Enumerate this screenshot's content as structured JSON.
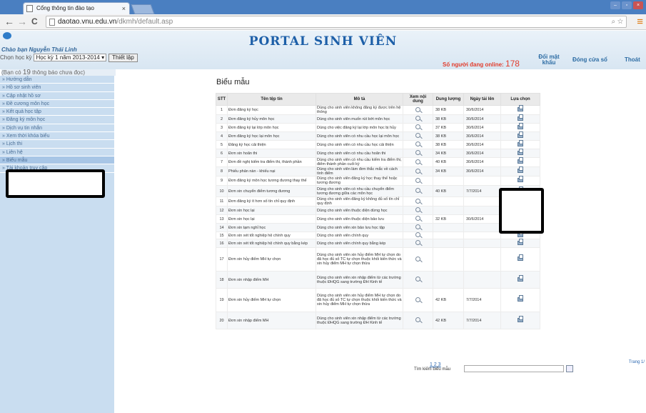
{
  "browser": {
    "tab_title": "Cổng thông tin đào tạo",
    "tab_close": "×",
    "url_host": "daotao.vnu.edu.vn",
    "url_path": "/dkmh/default.asp",
    "back": "←",
    "forward": "→",
    "reload": "C"
  },
  "header": {
    "portal_title": "PORTAL SINH VIÊN",
    "greeting": "Chào bạn Nguyễn Thái Linh",
    "semester_label": "Chọn học kỳ",
    "semester_value": "Học kỳ 1 năm 2013-2014",
    "setup_button": "Thiết lập",
    "online_label": "Số người đang online:",
    "online_count": "178",
    "change_password": "Đổi mật khẩu",
    "close_window": "Đóng cửa sổ",
    "logout": "Thoát"
  },
  "notice": {
    "prefix": "(Bạn có",
    "count": "19",
    "suffix": "thông báo chưa đọc)"
  },
  "sidebar": {
    "items": [
      {
        "label": "» Hướng dẫn"
      },
      {
        "label": "» Hồ sơ sinh viên"
      },
      {
        "label": "» Cập nhật hồ sơ"
      },
      {
        "label": "» Đề cương môn học"
      },
      {
        "label": "» Kết quả học tập"
      },
      {
        "label": "» Đăng ký môn học"
      },
      {
        "label": "» Dịch vụ tin nhắn"
      },
      {
        "label": "» Xem thời khóa biểu"
      },
      {
        "label": "» Lịch thi"
      },
      {
        "label": "» Liên hệ"
      },
      {
        "label": "» Biểu mẫu"
      },
      {
        "label": "» Tài khoản truy cập"
      }
    ]
  },
  "main": {
    "title": "Biểu mẫu",
    "columns": [
      "STT",
      "Tên tệp tin",
      "Mô tả",
      "Xem nội dung",
      "Dung lượng",
      "Ngày tải lên",
      "Lựa chọn"
    ],
    "rows": [
      {
        "stt": "1",
        "name": "Đơn đăng ký học",
        "desc": "Dùng cho sinh viên không đăng ký được trên hệ thống",
        "size": "38 KB",
        "date": "30/6/2014"
      },
      {
        "stt": "2",
        "name": "Đơn đăng ký hủy môn học",
        "desc": "Dùng cho sinh viên muốn rút bớt môn học",
        "size": "38 KB",
        "date": "30/6/2014"
      },
      {
        "stt": "3",
        "name": "Đơn đăng ký lại lớp môn học",
        "desc": "Dùng cho việc đăng ký lại lớp môn học bị hủy",
        "size": "37 KB",
        "date": "30/6/2014"
      },
      {
        "stt": "4",
        "name": "Đơn đăng ký học lại môn học",
        "desc": "Dùng cho sinh viên có nhu cầu học lại môn học",
        "size": "38 KB",
        "date": "30/6/2014"
      },
      {
        "stt": "5",
        "name": "Đăng ký học cải thiện",
        "desc": "Dùng cho sinh viên có nhu cầu học cải thiện",
        "size": "38 KB",
        "date": "30/6/2014"
      },
      {
        "stt": "6",
        "name": "Đơn xin hoãn thi",
        "desc": "Dùng cho sinh viên có nhu cầu hoãn thi",
        "size": "34 KB",
        "date": "30/6/2014"
      },
      {
        "stt": "7",
        "name": "Đơn đề nghị kiểm tra điểm thi, thành phần",
        "desc": "Dùng cho sinh viên có nhu cầu kiểm tra điểm thi, điểm thành phần cuối kỳ",
        "size": "40 KB",
        "date": "30/6/2014"
      },
      {
        "stt": "8",
        "name": "Phiếu phản nàn - khiếu nại",
        "desc": "Dùng cho sinh viên làm đơn thắc mắc về cách tính điểm",
        "size": "34 KB",
        "date": "30/6/2014"
      },
      {
        "stt": "9",
        "name": "Đơn đăng ký môn học tương đương thay thế",
        "desc": "Dùng cho sinh viên đăng ký học thay thế hoặc tương đương",
        "size": "",
        "date": ""
      },
      {
        "stt": "10",
        "name": "Đơn xin chuyển điểm tương đương",
        "desc": "Dùng cho sinh viên có nhu cầu chuyển điểm tương đương giữa các môn học",
        "size": "40 KB",
        "date": "7/7/2014"
      },
      {
        "stt": "11",
        "name": "Đơn đăng ký ít hơn số tín chỉ quy định",
        "desc": "Dùng cho sinh viên đăng ký không đủ số tín chỉ quy định",
        "size": "",
        "date": ""
      },
      {
        "stt": "12",
        "name": "Đơn xin học lại",
        "desc": "Dùng cho sinh viên thuộc diện dừng học",
        "size": "",
        "date": ""
      },
      {
        "stt": "13",
        "name": "Đơn xin học lại",
        "desc": "Dùng cho sinh viên thuộc diện bảo lưu",
        "size": "32 KB",
        "date": "30/6/2014"
      },
      {
        "stt": "14",
        "name": "Đơn xin tạm nghỉ học",
        "desc": "Dùng cho sinh viên xin bảo lưu học tập",
        "size": "",
        "date": ""
      },
      {
        "stt": "15",
        "name": "Đơn xin xét tốt nghiệp hệ chính quy",
        "desc": "Dùng cho sinh viên chính quy",
        "size": "",
        "date": ""
      },
      {
        "stt": "16",
        "name": "Đơn xin xét tốt nghiệp hệ chính quy bằng kép",
        "desc": "Dùng cho sinh viên chính quy bằng kép",
        "size": "",
        "date": ""
      },
      {
        "stt": "17",
        "name": "Đơn xin hủy điểm MH tự chọn",
        "desc": "Dùng cho sinh viên xin hủy điểm MH tự chọn do đã học đủ số TC tự chọn thuộc khối kiến thức và xin hủy điểm MH tự chọn thừa",
        "size": "",
        "date": ""
      },
      {
        "stt": "18",
        "name": "Đơn xin nhập điểm MH",
        "desc": "Dùng cho sinh viên xin nhập điểm từ các trường thuộc ĐHQG sang trường ĐH Kinh tế",
        "size": "",
        "date": ""
      },
      {
        "stt": "19",
        "name": "Đơn xin hủy điểm MH tự chọn",
        "desc": "Dùng cho sinh viên xin hủy điểm MH tự chọn do đã học đủ số TC tự chọn thuộc khối kiến thức và xin hủy điểm MH tự chọn thừa",
        "size": "42 KB",
        "date": "7/7/2014"
      },
      {
        "stt": "20",
        "name": "Đơn xin nhập điểm MH",
        "desc": "Dùng cho sinh viên xin nhập điểm từ các trường thuộc ĐHQG sang trường ĐH Kinh tế",
        "size": "42 KB",
        "date": "7/7/2014"
      }
    ],
    "pager": "1 2 3",
    "search_label": "Tìm kiếm biểu mẫu",
    "page_label": "Trang 1/"
  }
}
